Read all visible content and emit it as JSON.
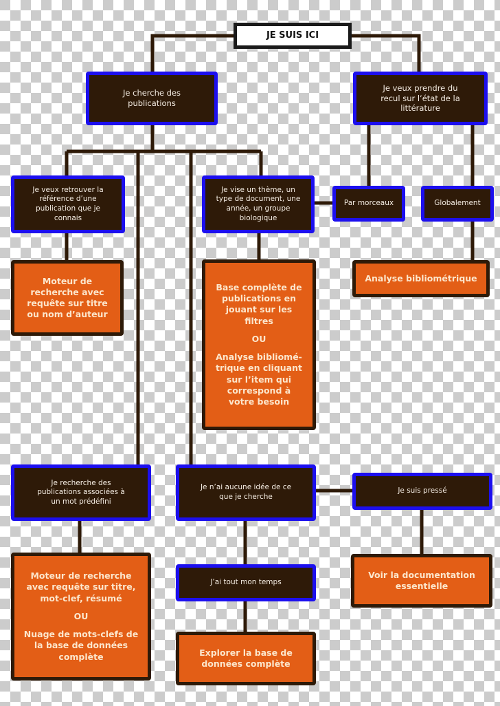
{
  "colors": {
    "question_fill": "#2e1a08",
    "question_border": "#1c0fef",
    "answer_fill": "#e35e16",
    "answer_border": "#2e1a08",
    "connector": "#2e1a08",
    "start_border": "#1a1a1a"
  },
  "start": {
    "label": "JE SUIS ICI"
  },
  "questions": {
    "search_publications": "Je cherche des publications",
    "step_back": "Je veux prendre du recul sur l’état de la littérature",
    "known_reference": "Je veux retrouver la référence d’une publication que je connais",
    "theme_filter": "Je vise un thème, un type de document, une année, un groupe biologique",
    "piecewise": "Par morceaux",
    "globally": "Globalement",
    "keyword": "Je recherche des publications associées à un mot prédéfini",
    "no_idea": "Je n’ai aucune idée de ce que je cherche",
    "in_a_hurry": "Je suis pressé",
    "have_time": "J’ai tout mon temps"
  },
  "answers": {
    "title_author_search": "Moteur de recherche avec requête sur titre ou nom d’auteur",
    "full_base": {
      "part1": "Base complète de publications en jouant sur les filtres",
      "or": "OU",
      "part2": "Analyse bibliomé-trique en cliquant sur l’item qui correspond à votre besoin"
    },
    "bibliometric": "Analyse bibliométrique",
    "keyword_search": {
      "part1": "Moteur de recherche avec requête sur titre, mot-clef, résumé",
      "or": "OU",
      "part2": "Nuage de mots-clefs de la base de données complète"
    },
    "essential_docs": "Voir la documentation essentielle",
    "explore_base": "Explorer la base de données complète"
  }
}
